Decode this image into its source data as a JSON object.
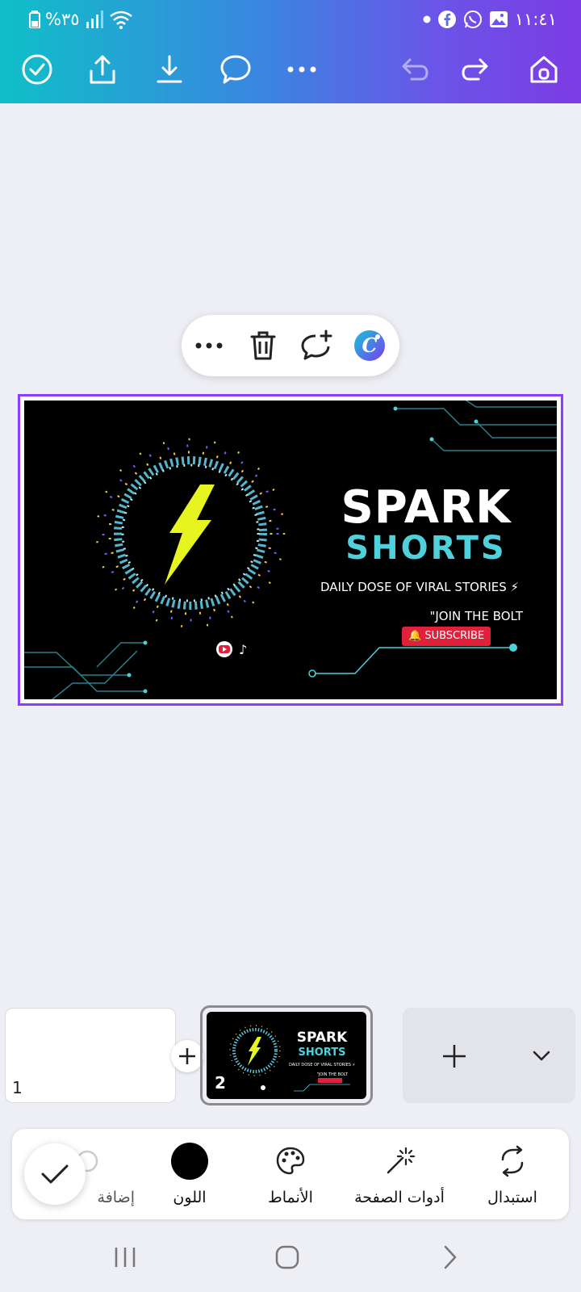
{
  "status_bar": {
    "battery_percent": "%٣٥",
    "time": "١١:٤١",
    "left_icons": [
      "battery-icon",
      "signal-icon",
      "wifi-icon"
    ],
    "right_icons": [
      "notification-dot-icon",
      "facebook-icon",
      "whatsapp-icon",
      "gallery-icon"
    ]
  },
  "toolbar": {
    "icons": [
      "check-circle-icon",
      "share-icon",
      "download-icon",
      "comment-icon",
      "more-icon",
      "undo-icon",
      "redo-icon",
      "home-icon"
    ]
  },
  "floating_menu": {
    "icons": [
      "more-icon",
      "trash-icon",
      "add-comment-icon",
      "canva-assistant-icon"
    ]
  },
  "design": {
    "title": "SPARK",
    "subtitle": "SHORTS",
    "tagline": "DAILY DOSE OF VIRAL STORIES ⚡",
    "join_text": "\"JOIN THE BOLT",
    "subscribe_label": "SUBSCRIBE",
    "accent_cyan": "#4fd1dc",
    "bolt_color": "#e6f51f",
    "subscribe_color": "#e0213c"
  },
  "pages": [
    {
      "number": "1",
      "selected": false
    },
    {
      "number": "2",
      "selected": true
    }
  ],
  "page_strip": {
    "add_between_icon": "plus-icon",
    "add_page_icon": "plus-icon",
    "expand_icon": "chevron-down-icon"
  },
  "bottom_panel": {
    "items": [
      {
        "label": "استبدال",
        "icon": "replace-icon"
      },
      {
        "label": "أدوات الصفحة",
        "icon": "magic-wand-icon"
      },
      {
        "label": "الأنماط",
        "icon": "palette-icon"
      },
      {
        "label": "اللون",
        "icon": "color-swatch-icon",
        "color": "#000000"
      },
      {
        "label": "إضافة",
        "icon": "add-icon"
      }
    ],
    "done_icon": "check-icon"
  },
  "nav_bar": {
    "icons": [
      "recent-apps-icon",
      "home-button-icon",
      "back-icon"
    ]
  },
  "colors": {
    "selection": "#8b3dff",
    "header_gradient": [
      "#0fbfc8",
      "#7d3be3"
    ]
  }
}
